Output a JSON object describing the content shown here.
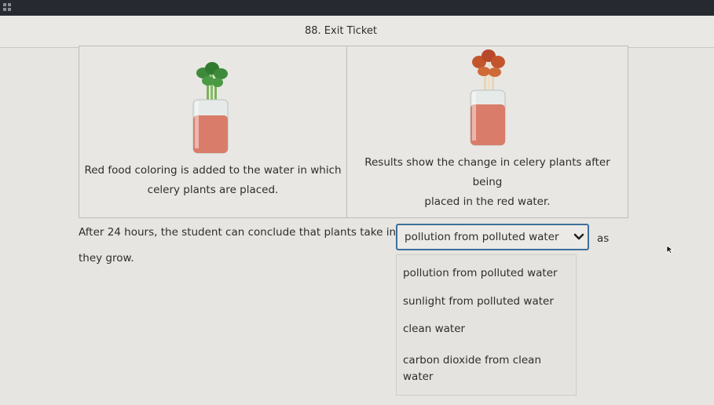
{
  "header": {
    "title": "88. Exit Ticket"
  },
  "table": {
    "left_caption": "Red food coloring is added to the water in which celery plants are placed.",
    "right_caption_lines": [
      "Results show the change in celery plants after",
      "being",
      "placed in the red water."
    ]
  },
  "question": {
    "prefix": "After 24 hours, the student can conclude that plants take in",
    "suffix": "as",
    "line2": "they grow."
  },
  "dropdown": {
    "selected": "pollution from polluted water",
    "options": [
      "pollution from polluted water",
      "sunlight from polluted water",
      "clean water",
      "carbon dioxide from clean water"
    ]
  },
  "colors": {
    "accent_border": "#3e6e9a",
    "leaf_green": "#3f8a3a",
    "leaf_red": "#c3552d",
    "water_red": "#d97d6a"
  },
  "icons": [
    "grid-icon",
    "chevron-down-icon",
    "cursor-icon",
    "celery-jar-green",
    "celery-jar-red"
  ]
}
